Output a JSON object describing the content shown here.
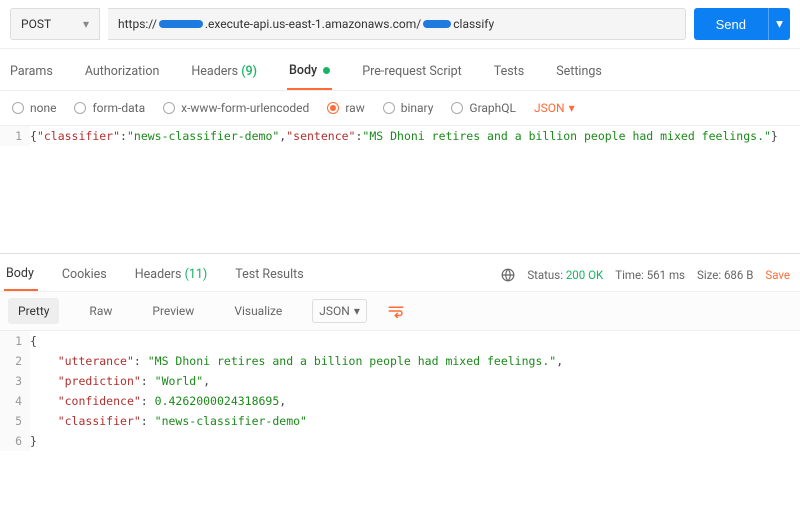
{
  "request": {
    "method": "POST",
    "url_prefix": "https://",
    "url_mid": ".execute-api.us-east-1.amazonaws.com/",
    "url_suffix": "classify",
    "send_label": "Send"
  },
  "reqtabs": {
    "params": "Params",
    "auth": "Authorization",
    "headers_label": "Headers",
    "headers_count": "(9)",
    "body": "Body",
    "prerequest": "Pre-request Script",
    "tests": "Tests",
    "settings": "Settings"
  },
  "bodytypes": {
    "none": "none",
    "form": "form-data",
    "xwww": "x-www-form-urlencoded",
    "raw": "raw",
    "binary": "binary",
    "graphql": "GraphQL",
    "json": "JSON"
  },
  "reqbody": {
    "ln": "1",
    "k1": "\"classifier\"",
    "v1": "\"news-classifier-demo\"",
    "k2": "\"sentence\"",
    "v2": "\"MS Dhoni retires and a billion people had mixed feelings.\""
  },
  "resptabs": {
    "body": "Body",
    "cookies": "Cookies",
    "headers_label": "Headers",
    "headers_count": "(11)",
    "tests": "Test Results"
  },
  "respmeta": {
    "status_label": "Status:",
    "status_val": "200 OK",
    "time_label": "Time:",
    "time_val": "561 ms",
    "size_label": "Size:",
    "size_val": "686 B",
    "save": "Save"
  },
  "resptoolbar": {
    "pretty": "Pretty",
    "raw": "Raw",
    "preview": "Preview",
    "visualize": "Visualize",
    "json": "JSON"
  },
  "respbody": {
    "l1": "1",
    "l2": "2",
    "l3": "3",
    "l4": "4",
    "l5": "5",
    "l6": "6",
    "k_utt": "\"utterance\"",
    "v_utt": "\"MS Dhoni retires and a billion people had mixed feelings.\"",
    "k_pred": "\"prediction\"",
    "v_pred": "\"World\"",
    "k_conf": "\"confidence\"",
    "v_conf": "0.4262000024318695",
    "k_cls": "\"classifier\"",
    "v_cls": "\"news-classifier-demo\""
  }
}
